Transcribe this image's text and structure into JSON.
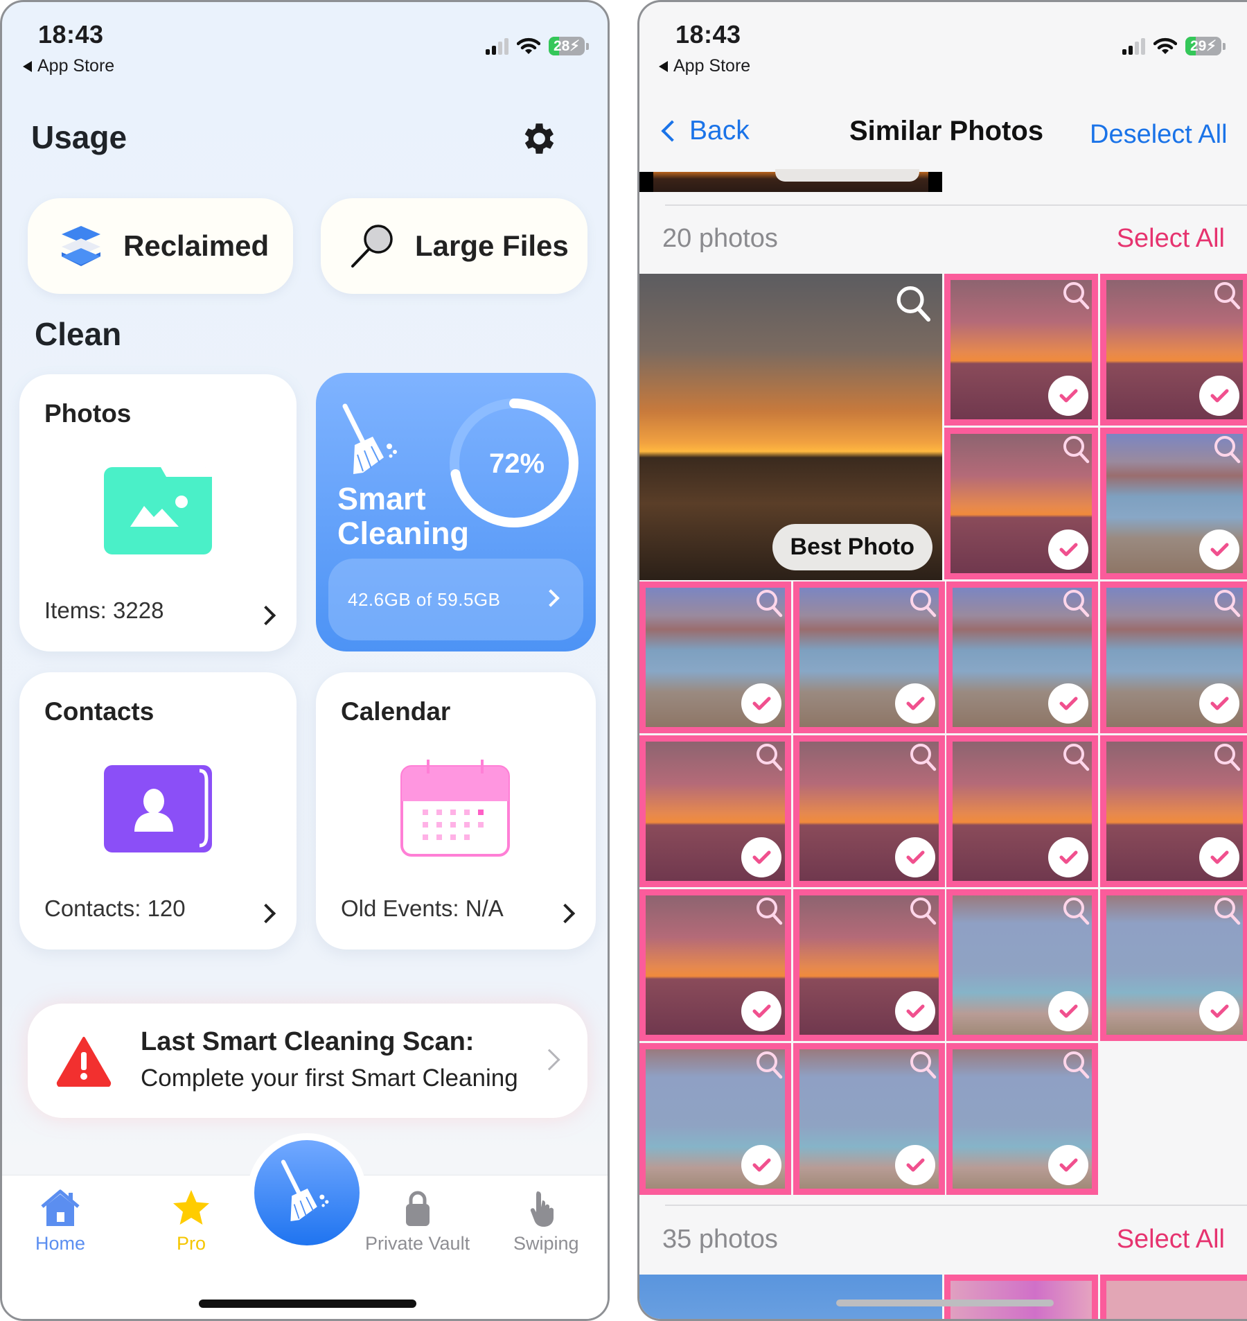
{
  "left_screen": {
    "status_bar": {
      "time": "18:43",
      "back_app": "App Store",
      "battery": "28",
      "battery_level": 0.28
    },
    "header": {
      "title": "Usage",
      "settings_icon": "gear-icon"
    },
    "quick_actions": [
      {
        "label": "Reclaimed",
        "icon": "layers-icon"
      },
      {
        "label": "Large Files",
        "icon": "magnifier-icon"
      }
    ],
    "section_title": "Clean",
    "cards": {
      "photos": {
        "title": "Photos",
        "detail": "Items: 3228",
        "icon": "photo-folder-icon",
        "color": "#4af0c8"
      },
      "smart_cleaning": {
        "title_line1": "Smart",
        "title_line2": "Cleaning",
        "percent_label": "72%",
        "percent": 0.72,
        "storage": "42.6GB of 59.5GB",
        "icon": "broom-icon"
      },
      "contacts": {
        "title": "Contacts",
        "detail": "Contacts: 120",
        "icon": "contact-book-icon",
        "color": "#8b4ff7"
      },
      "calendar": {
        "title": "Calendar",
        "detail": "Old Events: N/A",
        "icon": "calendar-icon",
        "color": "#ff8ee0"
      }
    },
    "alert": {
      "title": "Last Smart Cleaning Scan:",
      "message": "Complete your first Smart Cleaning",
      "icon": "warning-icon"
    },
    "tab_bar": {
      "tabs": [
        {
          "label": "Home",
          "icon": "home-icon",
          "color": "#5b8ef0",
          "active": true
        },
        {
          "label": "Pro",
          "icon": "star-icon",
          "color": "#ffcc00"
        },
        {
          "label": "Private Vault",
          "icon": "lock-icon",
          "color": "#8e8e93"
        },
        {
          "label": "Swiping",
          "icon": "hand-tap-icon",
          "color": "#8e8e93"
        }
      ],
      "center_button_icon": "broom-icon"
    }
  },
  "right_screen": {
    "status_bar": {
      "time": "18:43",
      "back_app": "App Store",
      "battery": "29",
      "battery_level": 0.29
    },
    "nav": {
      "back_label": "Back",
      "title": "Similar Photos",
      "action_label": "Deselect All"
    },
    "groups": [
      {
        "count_label": "20 photos",
        "select_label": "Select All",
        "best_photo_label": "Best Photo",
        "photos": [
          {
            "type": "sunset",
            "selected": false,
            "best": true
          },
          {
            "type": "sunset",
            "selected": true
          },
          {
            "type": "sunset",
            "selected": true
          },
          {
            "type": "sunset",
            "selected": true
          },
          {
            "type": "bay",
            "selected": true
          },
          {
            "type": "bay",
            "selected": true
          },
          {
            "type": "bay",
            "selected": true
          },
          {
            "type": "bay",
            "selected": true
          },
          {
            "type": "bay",
            "selected": true
          },
          {
            "type": "sunset",
            "selected": true
          },
          {
            "type": "sunset",
            "selected": true
          },
          {
            "type": "sunset",
            "selected": true
          },
          {
            "type": "sunset",
            "selected": true
          },
          {
            "type": "sunset",
            "selected": true
          },
          {
            "type": "sunset",
            "selected": true
          },
          {
            "type": "bay2",
            "selected": true
          },
          {
            "type": "bay2",
            "selected": true
          },
          {
            "type": "bay2",
            "selected": true
          },
          {
            "type": "bay2",
            "selected": true
          },
          {
            "type": "bay2",
            "selected": true
          }
        ]
      },
      {
        "count_label": "35 photos",
        "select_label": "Select All"
      }
    ],
    "colors": {
      "accent_blue": "#1a73e8",
      "select_pink": "#e6336f",
      "selection_border": "#fb5c9b"
    }
  }
}
